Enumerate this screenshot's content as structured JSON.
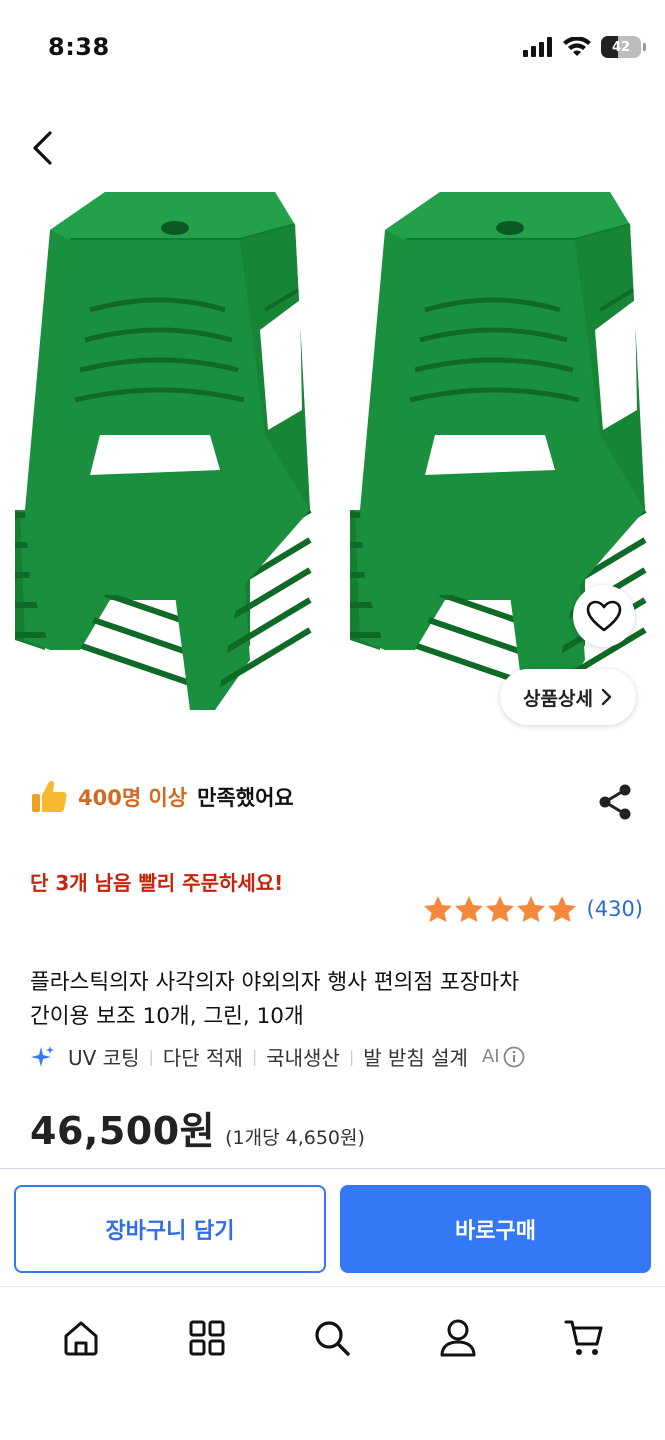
{
  "status_bar": {
    "time": "8:38",
    "battery": "42",
    "battery_level": 0.42,
    "icons": [
      "signal-icon",
      "wifi-icon",
      "battery-icon"
    ]
  },
  "nav": {
    "back_icon": "chevron-left-icon"
  },
  "hero": {
    "wish_icon": "heart-icon",
    "detail_label": "상품상세",
    "detail_icon": "chevron-right-icon"
  },
  "satisfaction": {
    "icon": "thumbs-up-icon",
    "highlight": "400명 이상",
    "text": "만족했어요"
  },
  "share_icon": "share-icon",
  "urgent": "단 3개 남음 빨리 주문하세요!",
  "rating": {
    "stars": 5,
    "max_stars": 5,
    "count": "(430)"
  },
  "product": {
    "title_line1": "플라스틱의자 사각의자 야외의자 행사 편의점 포장마차",
    "title_line2": "간이용 보조 10개, 그린, 10개",
    "features": [
      "UV 코팅",
      "다단 적재",
      "국내생산",
      "발 받침 설계"
    ],
    "ai_label": "AI",
    "price": "46,500원",
    "unit_price": "(1개당 4,650원)"
  },
  "actions": {
    "cart": "장바구니 담기",
    "buy": "바로구매"
  },
  "bottom_nav": [
    "home-icon",
    "category-icon",
    "search-icon",
    "my-page-icon",
    "cart-icon"
  ],
  "colors": {
    "accent": "#3478f6",
    "urgent": "#c8230a",
    "highlight": "#d2691e",
    "star": "#f5883a",
    "product_green": "#1a8f3e"
  }
}
